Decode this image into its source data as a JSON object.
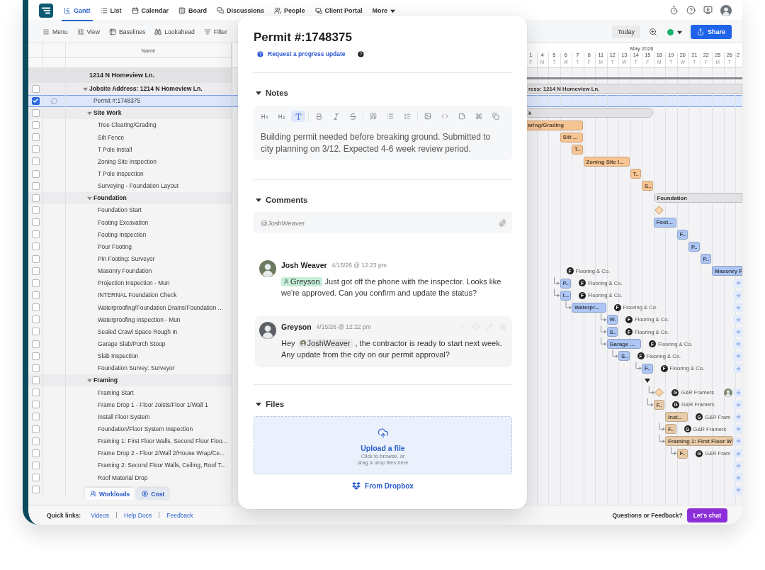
{
  "nav": {
    "tabs": [
      {
        "label": "Gantt",
        "selected": true
      },
      {
        "label": "List",
        "selected": false
      },
      {
        "label": "Calendar",
        "selected": false
      },
      {
        "label": "Board",
        "selected": false
      },
      {
        "label": "Discussions",
        "selected": false
      },
      {
        "label": "People",
        "selected": false
      },
      {
        "label": "Client Portal",
        "selected": false
      }
    ],
    "more": "More"
  },
  "toolbar": {
    "items": [
      "Menu",
      "View",
      "Baselines",
      "Lookahead",
      "Filter"
    ],
    "today": "Today",
    "share": "Share"
  },
  "table": {
    "column": "Name",
    "project": {
      "name": "1214 N Homeview Ln.",
      "bar": {
        "kind": "line",
        "color": "#8c8c8e"
      }
    },
    "rows": [
      {
        "name": "Jobsite Address: 1214 N Homeview Ln.",
        "checked": false,
        "selected": false,
        "comments": false,
        "expanded": true,
        "jump": false,
        "bar": {
          "kind": "summary",
          "label": "ress: 1214 N Homeview Ln.",
          "color": "#e2e2e4",
          "linked": false
        },
        "children": [
          {
            "name": "Permit #:1748375",
            "checked": true,
            "selected": true,
            "comments": true,
            "jump": false
          },
          {
            "name": "Site Work",
            "checked": false,
            "selected": false,
            "comments": false,
            "expanded": true,
            "jump": false,
            "bar": {
              "kind": "summary",
              "label": "k",
              "color": "#e2e2e4",
              "linked": false
            },
            "children": [
              {
                "name": "Tree Clearing/Grading",
                "checked": false,
                "selected": false,
                "comments": false,
                "jump": false,
                "bar": {
                  "kind": "task",
                  "label": "aring/Grading",
                  "color": "#f7c493",
                  "linked": false
                }
              },
              {
                "name": "Silt Fence",
                "checked": false,
                "selected": false,
                "comments": false,
                "jump": false,
                "bar": {
                  "kind": "task",
                  "label": "Silt ...",
                  "color": "#f7c493",
                  "linked": false
                }
              },
              {
                "name": "T Pole Install",
                "checked": false,
                "selected": false,
                "comments": false,
                "jump": false,
                "bar": {
                  "kind": "task",
                  "label": "T..",
                  "color": "#f7c493",
                  "linked": false
                }
              },
              {
                "name": "Zoning Site Inspection",
                "checked": false,
                "selected": false,
                "comments": false,
                "jump": false,
                "bar": {
                  "kind": "task",
                  "label": "Zoning Site I...",
                  "color": "#f7c493",
                  "linked": false
                }
              },
              {
                "name": "T Pole Inspection",
                "checked": false,
                "selected": false,
                "comments": false,
                "jump": false,
                "bar": {
                  "kind": "task",
                  "label": "T..",
                  "color": "#f7c493",
                  "linked": false
                }
              },
              {
                "name": "Surveying - Foundation Layout",
                "checked": false,
                "selected": false,
                "comments": false,
                "jump": false,
                "bar": {
                  "kind": "task",
                  "label": "S..",
                  "color": "#f7c493",
                  "linked": false
                }
              }
            ]
          },
          {
            "name": "Foundation",
            "checked": false,
            "selected": false,
            "comments": false,
            "expanded": true,
            "jump": false,
            "bar": {
              "kind": "summary",
              "label": "Foundation",
              "color": "#e2e2e4",
              "linked": false
            },
            "children": [
              {
                "name": "Foundation Start",
                "checked": false,
                "selected": false,
                "comments": false,
                "jump": false,
                "bar": {
                  "kind": "milestone",
                  "color": "#fbd7a9",
                  "linked": false
                }
              },
              {
                "name": "Footing Excavation",
                "checked": false,
                "selected": false,
                "comments": false,
                "jump": false,
                "bar": {
                  "kind": "task",
                  "label": "Foot...",
                  "color": "#adc6f4",
                  "linked": false
                }
              },
              {
                "name": "Footing Inspection",
                "checked": false,
                "selected": false,
                "comments": false,
                "jump": false,
                "bar": {
                  "kind": "task",
                  "label": "F..",
                  "color": "#adc6f4",
                  "linked": false
                }
              },
              {
                "name": "Pour Footing",
                "checked": false,
                "selected": false,
                "comments": false,
                "jump": false,
                "bar": {
                  "kind": "task",
                  "label": "P..",
                  "color": "#adc6f4",
                  "linked": false
                }
              },
              {
                "name": "Pin Footing: Surveyor",
                "checked": false,
                "selected": false,
                "comments": false,
                "jump": false,
                "bar": {
                  "kind": "task",
                  "label": "P..",
                  "color": "#adc6f4",
                  "linked": false
                }
              },
              {
                "name": "Masonry Foundation",
                "checked": false,
                "selected": false,
                "comments": false,
                "jump": false,
                "bar": {
                  "kind": "task",
                  "label": "Masonry F",
                  "color": "#adc6f4",
                  "linked": false
                },
                "assignee": {
                  "initial": "F",
                  "name": "Flooring & Co.",
                  "extra_avatar": false
                }
              },
              {
                "name": "Projection Inspection - Mun",
                "checked": false,
                "selected": false,
                "comments": false,
                "jump": true,
                "bar": {
                  "kind": "task",
                  "label": "P..",
                  "color": "#adc6f4",
                  "linked": true
                },
                "assignee": {
                  "initial": "F",
                  "name": "Flooring & Co.",
                  "extra_avatar": false
                }
              },
              {
                "name": "INTERNAL Foundation Check",
                "checked": false,
                "selected": false,
                "comments": false,
                "jump": true,
                "bar": {
                  "kind": "task",
                  "label": "I...",
                  "color": "#adc6f4",
                  "linked": true
                },
                "assignee": {
                  "initial": "F",
                  "name": "Flooring & Co.",
                  "extra_avatar": false
                }
              },
              {
                "name": "Waterproofing/Foundation Drains/Foundation ...",
                "checked": false,
                "selected": false,
                "comments": false,
                "jump": true,
                "bar": {
                  "kind": "task",
                  "label": "Waterpr...",
                  "color": "#adc6f4",
                  "linked": true
                },
                "assignee": {
                  "initial": "F",
                  "name": "Flooring & Co.",
                  "extra_avatar": false
                }
              },
              {
                "name": "Waterproofing Inspection - Mun",
                "checked": false,
                "selected": false,
                "comments": false,
                "jump": true,
                "bar": {
                  "kind": "task",
                  "label": "W.",
                  "color": "#adc6f4",
                  "linked": true
                },
                "assignee": {
                  "initial": "F",
                  "name": "Flooring & Co.",
                  "extra_avatar": false
                }
              },
              {
                "name": "Sealed Crawl Space Rough In",
                "checked": false,
                "selected": false,
                "comments": false,
                "jump": true,
                "bar": {
                  "kind": "task",
                  "label": "S..",
                  "color": "#adc6f4",
                  "linked": true
                },
                "assignee": {
                  "initial": "F",
                  "name": "Flooring & Co.",
                  "extra_avatar": false
                }
              },
              {
                "name": "Garage Slab/Porch Stoop",
                "checked": false,
                "selected": false,
                "comments": false,
                "jump": true,
                "bar": {
                  "kind": "task",
                  "label": "Garage ...",
                  "color": "#adc6f4",
                  "linked": true
                },
                "assignee": {
                  "initial": "F",
                  "name": "Flooring & Co.",
                  "extra_avatar": false
                }
              },
              {
                "name": "Slab Inspection",
                "checked": false,
                "selected": false,
                "comments": false,
                "jump": true,
                "bar": {
                  "kind": "task",
                  "label": "S..",
                  "color": "#adc6f4",
                  "linked": true
                },
                "assignee": {
                  "initial": "F",
                  "name": "Flooring & Co.",
                  "extra_avatar": false
                }
              },
              {
                "name": "Foundation Survey: Surveyor",
                "checked": false,
                "selected": false,
                "comments": false,
                "jump": true,
                "bar": {
                  "kind": "task",
                  "label": "F..",
                  "color": "#adc6f4",
                  "linked": true
                },
                "assignee": {
                  "initial": "F",
                  "name": "Flooring & Co.",
                  "extra_avatar": false
                }
              }
            ]
          },
          {
            "name": "Framing",
            "checked": false,
            "selected": false,
            "comments": false,
            "expanded": true,
            "jump": false,
            "bar": {
              "kind": "toggle"
            },
            "children": [
              {
                "name": "Framing Start",
                "checked": false,
                "selected": false,
                "comments": false,
                "jump": true,
                "bar": {
                  "kind": "milestone",
                  "color": "#fbd7a9",
                  "linked": true
                },
                "assignee": {
                  "initial": "G",
                  "name": "G&R Framers",
                  "extra_avatar": true
                }
              },
              {
                "name": "Frame Drop 1 - Floor Joists/Floor 1/Wall 1",
                "checked": false,
                "selected": false,
                "comments": false,
                "jump": true,
                "bar": {
                  "kind": "task",
                  "label": "F..",
                  "color": "#e8cba8",
                  "linked": true
                },
                "assignee": {
                  "initial": "G",
                  "name": "G&R Framers",
                  "extra_avatar": false
                }
              },
              {
                "name": "Install Floor System",
                "checked": false,
                "selected": false,
                "comments": false,
                "jump": true,
                "bar": {
                  "kind": "task",
                  "label": "Inst...",
                  "color": "#e8cba8",
                  "linked": false
                },
                "assignee": {
                  "initial": "G",
                  "name": "G&R Fram",
                  "extra_avatar": false
                }
              },
              {
                "name": "Foundation/Floor System Inspection",
                "checked": false,
                "selected": false,
                "comments": false,
                "jump": true,
                "bar": {
                  "kind": "task",
                  "label": "F..",
                  "color": "#e8cba8",
                  "linked": true
                },
                "assignee": {
                  "initial": "G",
                  "name": "G&R Framers",
                  "extra_avatar": false
                }
              },
              {
                "name": "Framing 1: First Floor Walls, Second Floor Floo...",
                "checked": false,
                "selected": false,
                "comments": false,
                "jump": true,
                "bar": {
                  "kind": "task",
                  "label": "Framing 1: First Floor W",
                  "color": "#e8cba8",
                  "linked": true
                }
              },
              {
                "name": "Frame Drop 2 - Floor 2/Wall 2/House Wrap/Ce...",
                "checked": false,
                "selected": false,
                "comments": false,
                "jump": true,
                "bar": {
                  "kind": "task",
                  "label": "F..",
                  "color": "#e8cba8",
                  "linked": true
                },
                "assignee": {
                  "initial": "G",
                  "name": "G&R Fram",
                  "extra_avatar": false
                }
              },
              {
                "name": "Framing 2: Second Floor Walls, Ceiling, Roof T...",
                "checked": false,
                "selected": false,
                "comments": false,
                "jump": true
              },
              {
                "name": "Roof Material Drop",
                "checked": false,
                "selected": false,
                "comments": false,
                "jump": true
              },
              {
                "checked": false,
                "selected": false,
                "comments": false,
                "jump": true
              }
            ]
          }
        ]
      }
    ]
  },
  "panel_tabs": [
    {
      "label": "Workloads",
      "selected": true
    },
    {
      "label": "Cost",
      "selected": false
    }
  ],
  "gantt": {
    "month": "May 2026",
    "columns": [
      {
        "date": "1",
        "day": "F"
      },
      {
        "date": "4",
        "day": "M"
      },
      {
        "date": "5",
        "day": "T"
      },
      {
        "date": "6",
        "day": "W"
      },
      {
        "date": "7",
        "day": "T"
      },
      {
        "date": "8",
        "day": "F"
      },
      {
        "date": "11",
        "day": "M"
      },
      {
        "date": "12",
        "day": "T"
      },
      {
        "date": "13",
        "day": "W"
      },
      {
        "date": "14",
        "day": "T"
      },
      {
        "date": "15",
        "day": "F"
      },
      {
        "date": "18",
        "day": "M"
      },
      {
        "date": "19",
        "day": "T"
      },
      {
        "date": "20",
        "day": "W"
      },
      {
        "date": "21",
        "day": "T"
      },
      {
        "date": "22",
        "day": "F"
      },
      {
        "date": "25",
        "day": "M"
      },
      {
        "date": "26",
        "day": "T"
      },
      {
        "date": "2"
      }
    ]
  },
  "modal": {
    "title": "Permit #:1748375",
    "progress_link": "Request a progress update",
    "notes": {
      "heading": "Notes",
      "expanded": true,
      "format_tools": [
        {
          "kind": "heading1",
          "selected": false
        },
        {
          "kind": "heading2",
          "selected": false
        },
        {
          "kind": "paragraph",
          "selected": true
        },
        {
          "kind": "bold",
          "selected": false
        },
        {
          "kind": "italic",
          "selected": false
        },
        {
          "kind": "strike",
          "selected": false
        }
      ],
      "text": "Building permit needed before breaking ground. Submitted to city planning on 3/12. Expected 4-6 week review period."
    },
    "comments": {
      "heading": "Comments",
      "expanded": true,
      "input": {
        "value": "@JoshWeaver"
      },
      "items": [
        {
          "author": "Josh Weaver",
          "time": "4/15/26 @ 12:23 pm",
          "highlighted": false,
          "mention": {
            "name": "Greyson",
            "kind": "person",
            "color": "#c6eed8"
          },
          "after": "Just got off the phone with the inspector. Looks like we're approved. Can you confirm and update the status?"
        },
        {
          "author": "Greyson",
          "time": "4/15/26 @ 12:22 pm",
          "highlighted": true,
          "before": "Hey",
          "mention": {
            "name": "JoshWeaver",
            "kind": "avatar",
            "color": "#e9e9eb"
          },
          "after": ", the contractor is ready to start next week. Any update from the city on our permit approval?"
        }
      ]
    },
    "files": {
      "heading": "Files",
      "expanded": true,
      "upload_title": "Upload a file",
      "upload_hint": "Click to browse, or drag & drop files here",
      "dropbox": "From Dropbox"
    }
  },
  "footer": {
    "label": "Quick links:",
    "links": [
      "Videos",
      "Help Docs",
      "Feedback"
    ],
    "question": "Questions or Feedback?",
    "chat": "Let's chat"
  }
}
